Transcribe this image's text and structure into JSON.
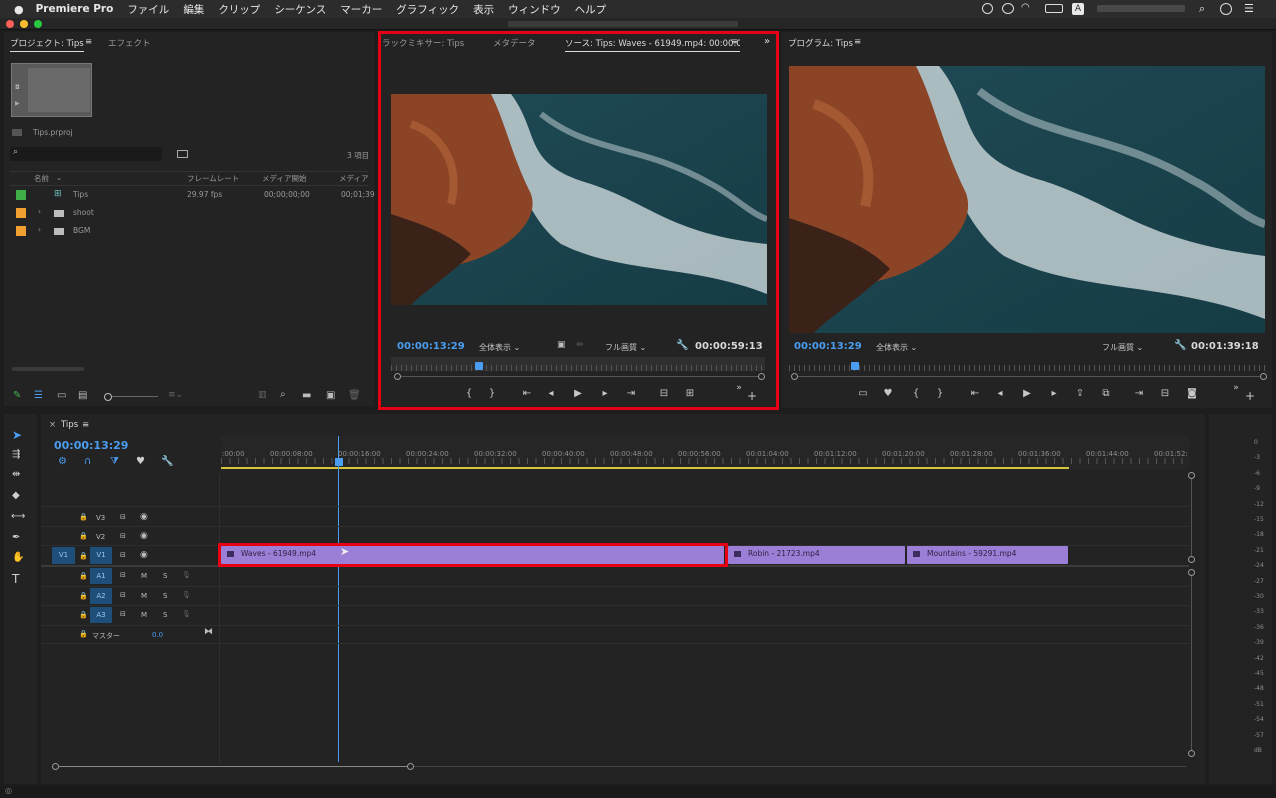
{
  "menubar": {
    "apple": "",
    "app_name": "Premiere Pro",
    "items": [
      "ファイル",
      "編集",
      "クリップ",
      "シーケンス",
      "マーカー",
      "グラフィック",
      "表示",
      "ウィンドウ",
      "ヘルプ"
    ],
    "status_icon_a": "A"
  },
  "project": {
    "tab_project": "プロジェクト: Tips",
    "tab_effect": "エフェクト",
    "file_name": "Tips.prproj",
    "item_count": "3 項目",
    "col_name": "名前",
    "col_framerate": "フレームレート",
    "col_media_start": "メディア開始",
    "col_media": "メディア",
    "rows": [
      {
        "name": "Tips",
        "fps": "29.97 fps",
        "start": "00;00;00;00",
        "end": "00;01;39",
        "color": "#3fae49"
      },
      {
        "name": "shoot",
        "fps": "",
        "start": "",
        "end": "",
        "color": "#f0a030"
      },
      {
        "name": "BGM",
        "fps": "",
        "start": "",
        "end": "",
        "color": "#f0a030"
      }
    ]
  },
  "source": {
    "tab_audio_mixer": "ラックミキサー: Tips",
    "tab_metadata": "メタデータ",
    "tab_source": "ソース: Tips: Waves - 61949.mp4: 00:00:00:00",
    "timecode": "00:00:13:29",
    "zoom": "全体表示",
    "quality": "フル画質",
    "duration": "00:00:59:13"
  },
  "program": {
    "tab": "プログラム: Tips",
    "timecode": "00:00:13:29",
    "zoom": "全体表示",
    "quality": "フル画質",
    "duration": "00:01:39:18"
  },
  "timeline": {
    "tab": "Tips",
    "timecode": "00:00:13:29",
    "ruler": [
      ":00:00",
      "00:00:08:00",
      "00:00:16:00",
      "00:00:24:00",
      "00:00:32:00",
      "00:00:40:00",
      "00:00:48:00",
      "00:00:56:00",
      "00:01:04:00",
      "00:01:12:00",
      "00:01:20:00",
      "00:01:28:00",
      "00:01:36:00",
      "00:01:44:00",
      "00:01:52:"
    ],
    "video_tracks": [
      "V3",
      "V2",
      "V1"
    ],
    "audio_tracks": [
      "A1",
      "A2",
      "A3"
    ],
    "source_patch": "V1",
    "master_label": "マスター",
    "master_value": "0.0",
    "mute_label": "M",
    "solo_label": "S",
    "clips": [
      {
        "name": "Waves - 61949.mp4"
      },
      {
        "name": "Robin - 21723.mp4"
      },
      {
        "name": "Mountains - 59291.mp4"
      }
    ]
  },
  "meter_scale": [
    "0",
    "-3",
    "-6",
    "-9",
    "-12",
    "-15",
    "-18",
    "-21",
    "-24",
    "-27",
    "-30",
    "-33",
    "-36",
    "-39",
    "-42",
    "-45",
    "-48",
    "-51",
    "-54",
    "-57",
    "dB"
  ]
}
